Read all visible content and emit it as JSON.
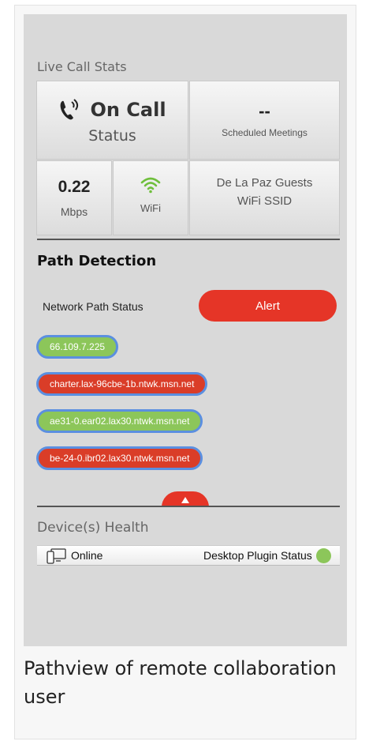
{
  "live_call_stats": {
    "title": "Live Call Stats",
    "call_status": "On Call",
    "status_label": "Status",
    "scheduled_meetings_value": "--",
    "scheduled_meetings_label": "Scheduled Meetings",
    "bandwidth_value": "0.22",
    "bandwidth_unit": "Mbps",
    "connection_label": "WiFi",
    "ssid_name": "De La Paz Guests",
    "ssid_label": "WiFi SSID"
  },
  "path_detection": {
    "title": "Path Detection",
    "network_path_status_label": "Network Path Status",
    "alert_label": "Alert",
    "hops": [
      {
        "label": "66.109.7.225",
        "status": "ok"
      },
      {
        "label": "charter.lax-96cbe-1b.ntwk.msn.net",
        "status": "alert"
      },
      {
        "label": "ae31-0.ear02.lax30.ntwk.msn.net",
        "status": "ok"
      },
      {
        "label": "be-24-0.ibr02.lax30.ntwk.msn.net",
        "status": "alert"
      }
    ]
  },
  "device_health": {
    "title": "Device(s) Health",
    "device_status": "Online",
    "plugin_status_label": "Desktop Plugin Status",
    "plugin_status": "ok"
  },
  "caption": "Pathview of remote collaboration user",
  "colors": {
    "alert_red": "#e53527",
    "ok_green": "#8cc65a",
    "hop_border": "#5b8fe0",
    "panel_gray": "#d9d9d9"
  },
  "icons": {
    "phone": "phone-call-icon",
    "wifi": "wifi-icon",
    "device": "devices-icon",
    "toggle": "triangle-up-icon"
  }
}
